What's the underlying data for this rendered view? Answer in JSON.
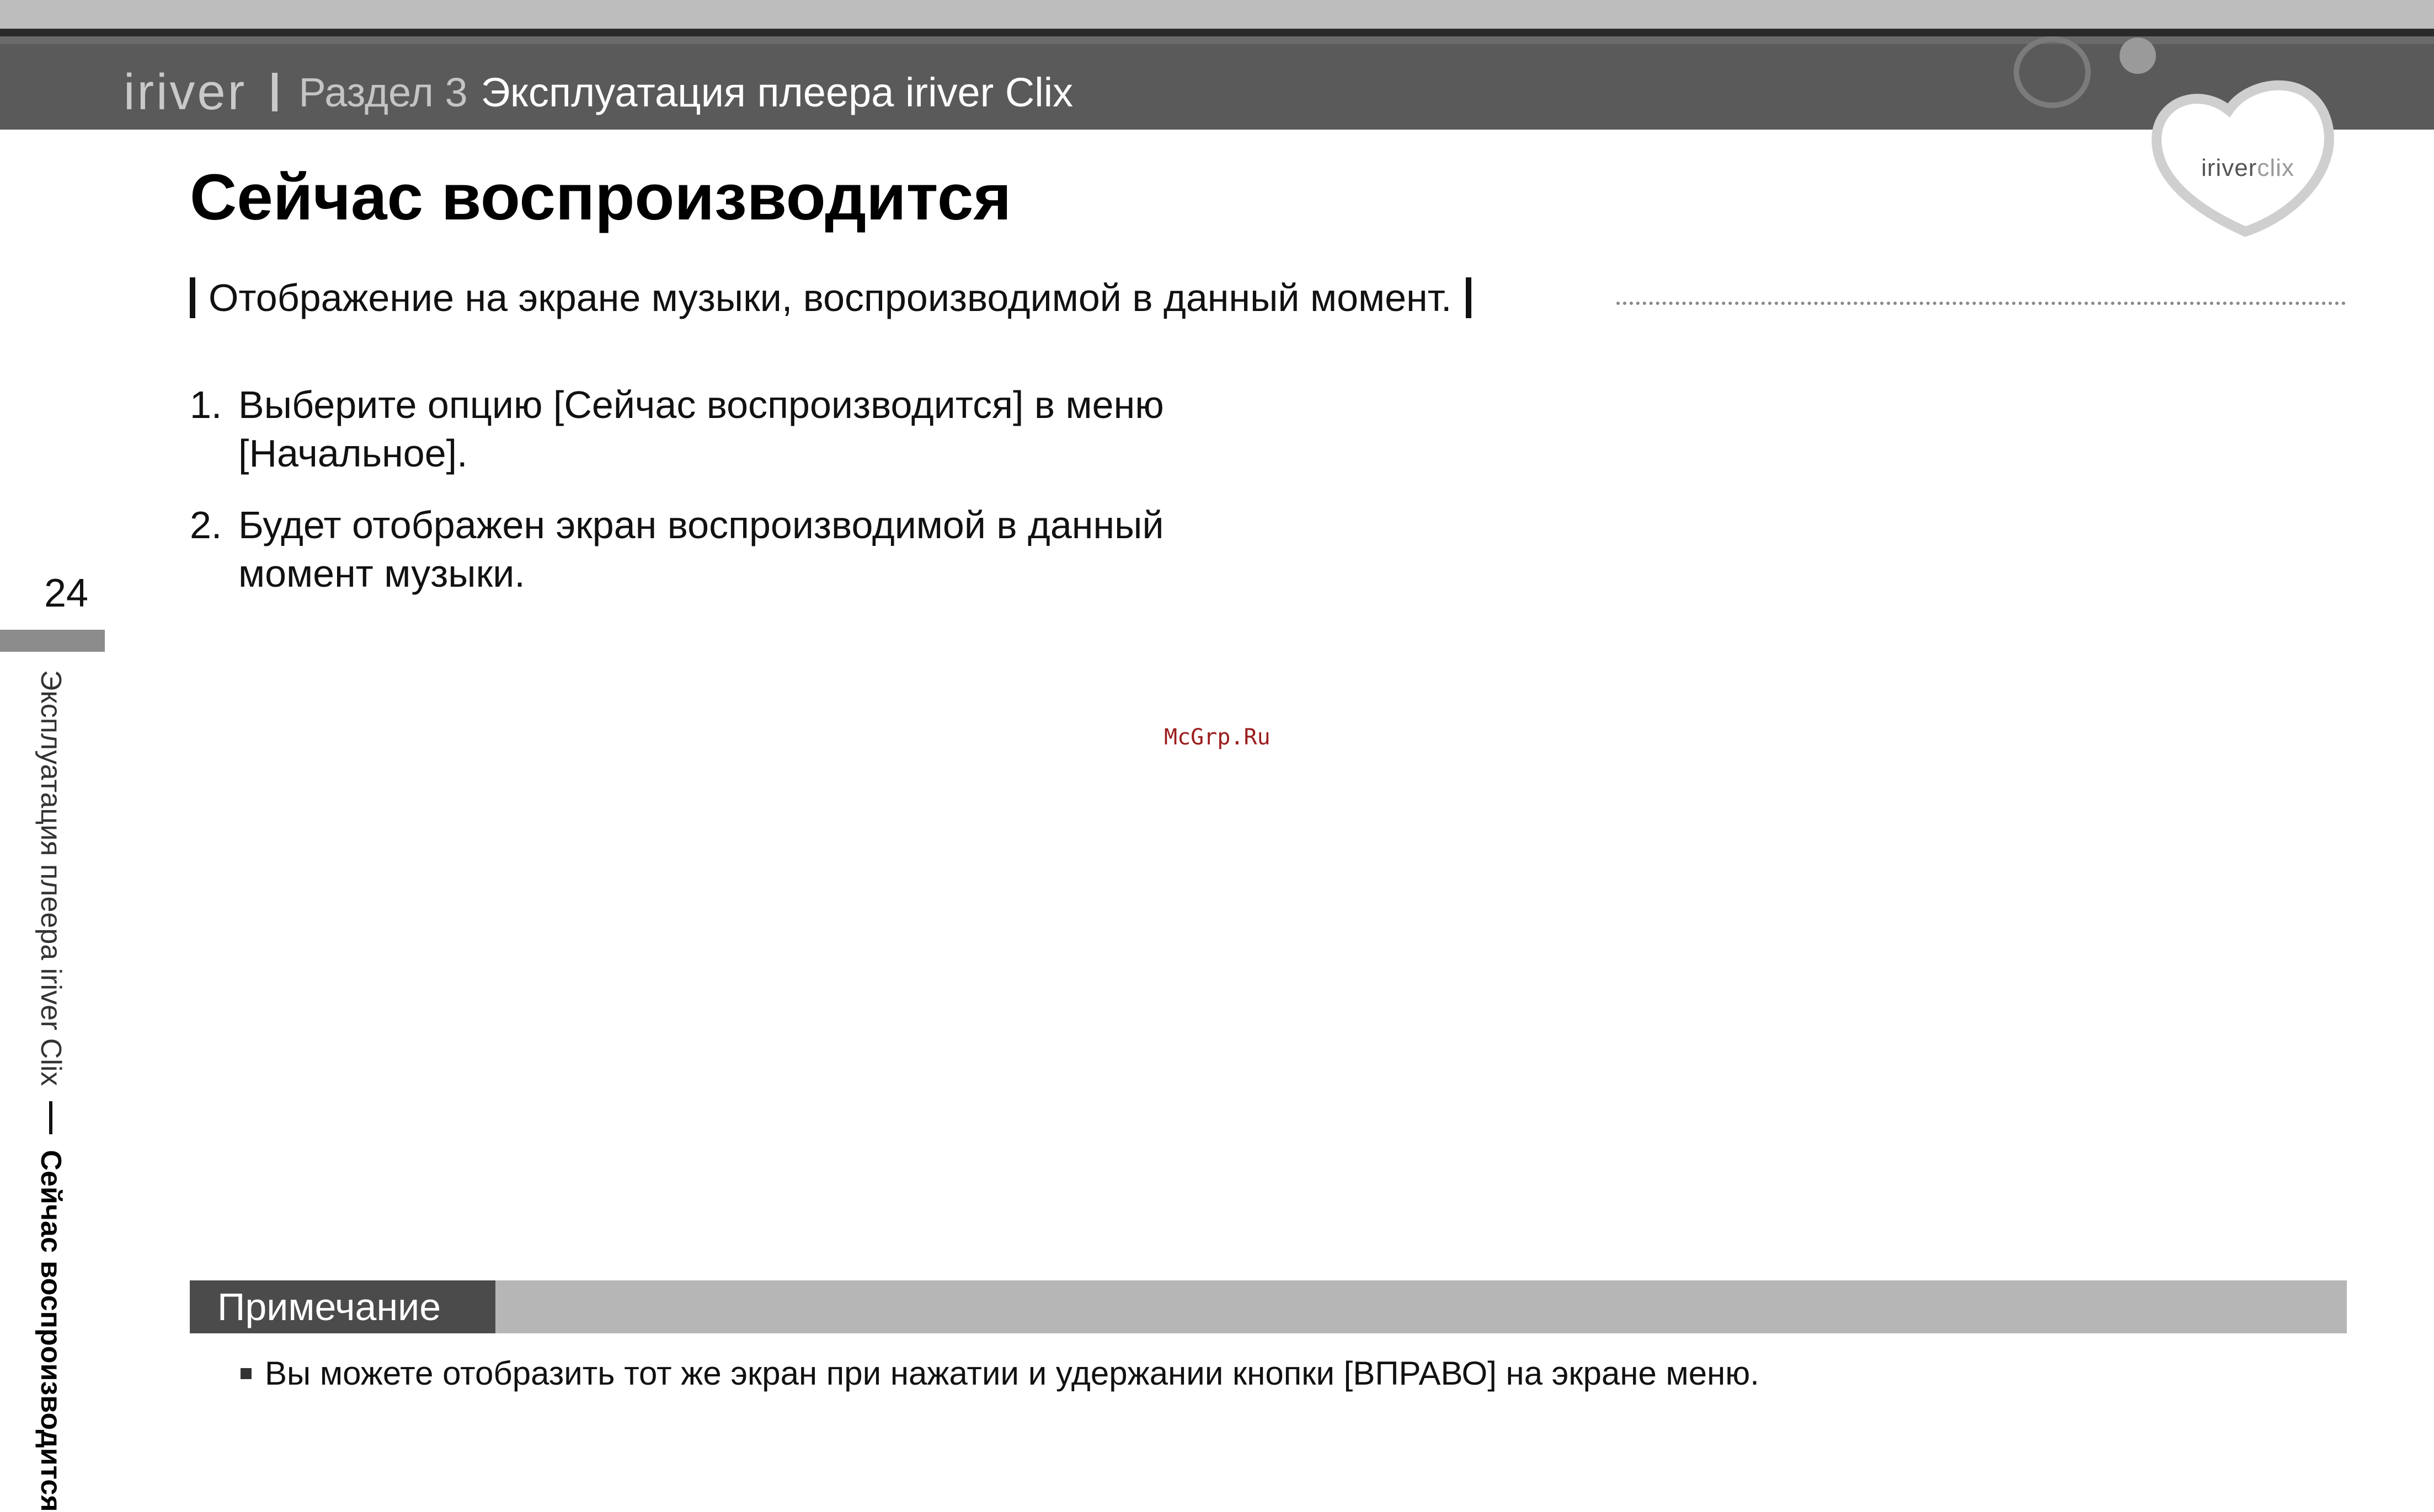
{
  "header": {
    "brand": "iriver",
    "section": "Раздел 3",
    "chapter": "Эксплуатация плеера iriver Clix"
  },
  "logo": {
    "text_main": "iriver",
    "text_sub": "clix"
  },
  "page": {
    "title": "Сейчас воспроизводится",
    "subtitle": "Отображение на экране музыки, воспроизводимой в данный момент.",
    "steps": [
      {
        "num": "1.",
        "text": "Выберите опцию [Сейчас воспроизводится] в меню [Начальное]."
      },
      {
        "num": "2.",
        "text": "Будет отображен экран воспроизводимой в данный момент музыки."
      }
    ]
  },
  "sidebar": {
    "page_number": "24",
    "chapter": "Эксплуатация плеера iriver Clix",
    "current": "Сейчас воспроизводится"
  },
  "watermark": "McGrp.Ru",
  "note": {
    "label": "Примечание",
    "text": "Вы можете отобразить тот же экран при нажатии и удержании кнопки [ВПРАВО] на экране меню."
  }
}
